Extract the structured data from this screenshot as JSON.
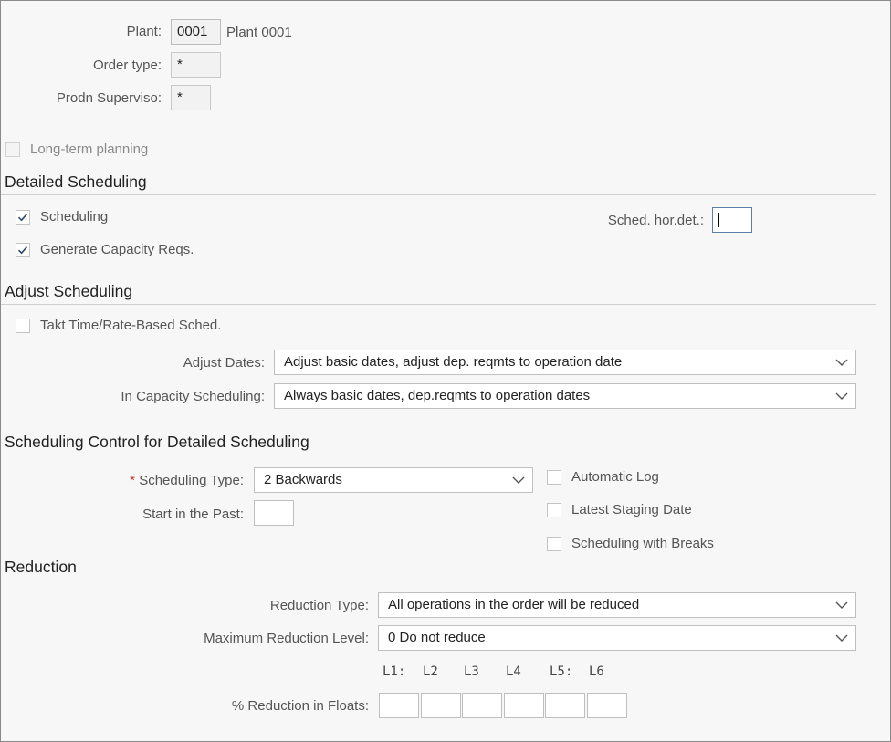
{
  "header": {
    "plant_label": "Plant:",
    "plant_value": "0001",
    "plant_desc": "Plant 0001",
    "order_type_label": "Order type:",
    "order_type_value": "*",
    "prodn_supervisor_label": "Prodn Superviso:",
    "prodn_supervisor_value": "*",
    "long_term_label": "Long-term planning",
    "long_term_checked": false
  },
  "detailed": {
    "title": "Detailed Scheduling",
    "scheduling_label": "Scheduling",
    "scheduling_checked": true,
    "capacity_label": "Generate Capacity Reqs.",
    "capacity_checked": true,
    "sched_hor_label": "Sched. hor.det.:",
    "sched_hor_value": ""
  },
  "adjust": {
    "title": "Adjust Scheduling",
    "takt_label": "Takt Time/Rate-Based Sched.",
    "takt_checked": false,
    "adjust_dates_label": "Adjust Dates:",
    "adjust_dates_value": "Adjust basic dates, adjust dep. reqmts to operation date",
    "in_capacity_label": "In Capacity Scheduling:",
    "in_capacity_value": "Always basic dates, dep.reqmts to operation dates"
  },
  "control": {
    "title": "Scheduling Control for Detailed Scheduling",
    "required_mark": "*",
    "type_label": "Scheduling Type:",
    "type_value": "2 Backwards",
    "start_past_label": "Start in the Past:",
    "start_past_value": "",
    "auto_log_label": "Automatic Log",
    "latest_staging_label": "Latest Staging Date",
    "breaks_label": "Scheduling with Breaks"
  },
  "reduction": {
    "title": "Reduction",
    "type_label": "Reduction Type:",
    "type_value": "All operations in the order will be reduced",
    "max_level_label": "Maximum Reduction Level:",
    "max_level_value": "0 Do not reduce",
    "level_headers": [
      "L1:",
      "L2",
      "L3",
      "L4",
      "L5:",
      "L6"
    ],
    "floats_label": "% Reduction in Floats:",
    "floats_values": [
      "",
      "",
      "",
      "",
      "",
      ""
    ]
  },
  "colors": {
    "section_rule": "#cfcfcf",
    "checkmark": "#2b4a6e",
    "focus_border": "#5a7fa3"
  },
  "icons": {
    "check": "checkmark-icon",
    "dropdown": "chevron-down-icon"
  }
}
